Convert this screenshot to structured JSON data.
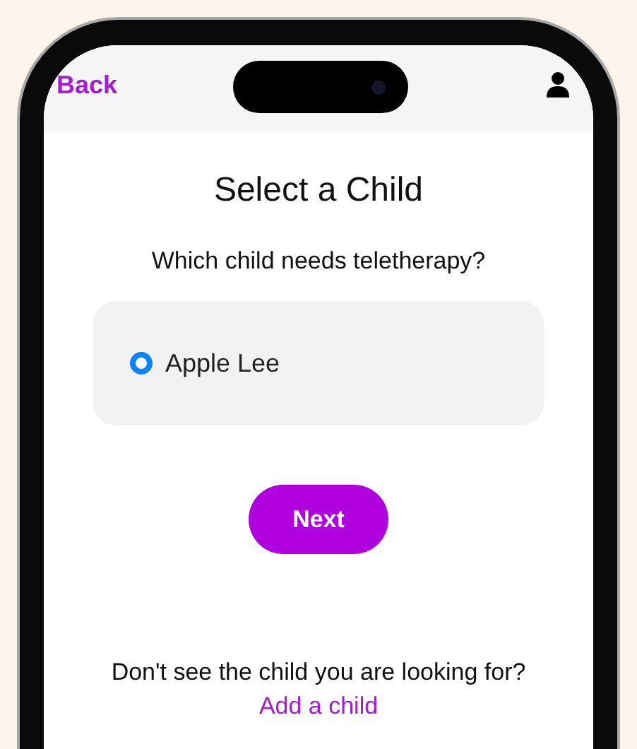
{
  "header": {
    "back": "Back"
  },
  "title": "Select a Child",
  "subtitle": "Which child needs teletherapy?",
  "children": [
    {
      "name": "Apple Lee",
      "selected": true
    }
  ],
  "next_button": "Next",
  "footer": {
    "prompt": "Don't see the child you are looking for?",
    "link": "Add a child"
  }
}
